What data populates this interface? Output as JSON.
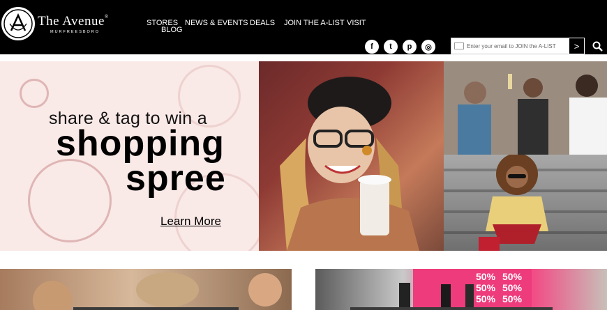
{
  "brand": {
    "title": "The Avenue",
    "reg_mark": "®",
    "subtitle": "MURFREESBORO"
  },
  "nav": {
    "stores": "STORES",
    "blog": "BLOG",
    "news_events": "NEWS & EVENTS",
    "deals": "DEALS",
    "join": "JOIN THE A-LIST",
    "visit": "VISIT"
  },
  "social": {
    "facebook": "f",
    "twitter": "t",
    "pinterest": "p",
    "instagram": "◎"
  },
  "signup": {
    "placeholder": "Enter your email to JOIN the A-LIST",
    "submit_label": ">"
  },
  "hero": {
    "line1": "share & tag to win a",
    "line2": "shopping",
    "line3": "spree",
    "cta": "Learn More"
  },
  "colors": {
    "header_bg": "#000000",
    "hero_bg": "#f9e9e7",
    "stamp": "#be7878"
  },
  "icons": [
    "facebook-icon",
    "twitter-icon",
    "pinterest-icon",
    "instagram-icon",
    "mail-icon",
    "search-icon"
  ]
}
